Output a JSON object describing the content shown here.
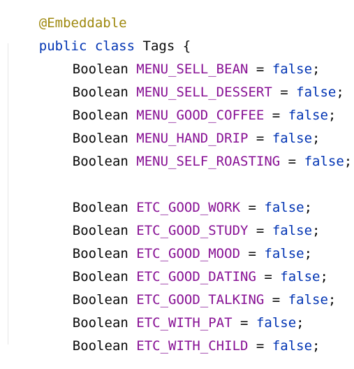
{
  "code": {
    "annotation": "@Embeddable",
    "class_decl": {
      "modifier": "public",
      "keyword": "class",
      "name": "Tags",
      "brace": "{"
    },
    "field_type": "Boolean",
    "assign": "=",
    "value": "false",
    "terminator": ";",
    "fields": [
      "MENU_SELL_BEAN",
      "MENU_SELL_DESSERT",
      "MENU_GOOD_COFFEE",
      "MENU_HAND_DRIP",
      "MENU_SELF_ROASTING",
      "ETC_GOOD_WORK",
      "ETC_GOOD_STUDY",
      "ETC_GOOD_MOOD",
      "ETC_GOOD_DATING",
      "ETC_GOOD_TALKING",
      "ETC_WITH_PAT",
      "ETC_WITH_CHILD"
    ]
  },
  "colors": {
    "background": "#ffffff",
    "annotation": "#9e880d",
    "keyword": "#0033b3",
    "field_name": "#871094",
    "text": "#080808",
    "indent_guide": "#e6e6e6"
  }
}
